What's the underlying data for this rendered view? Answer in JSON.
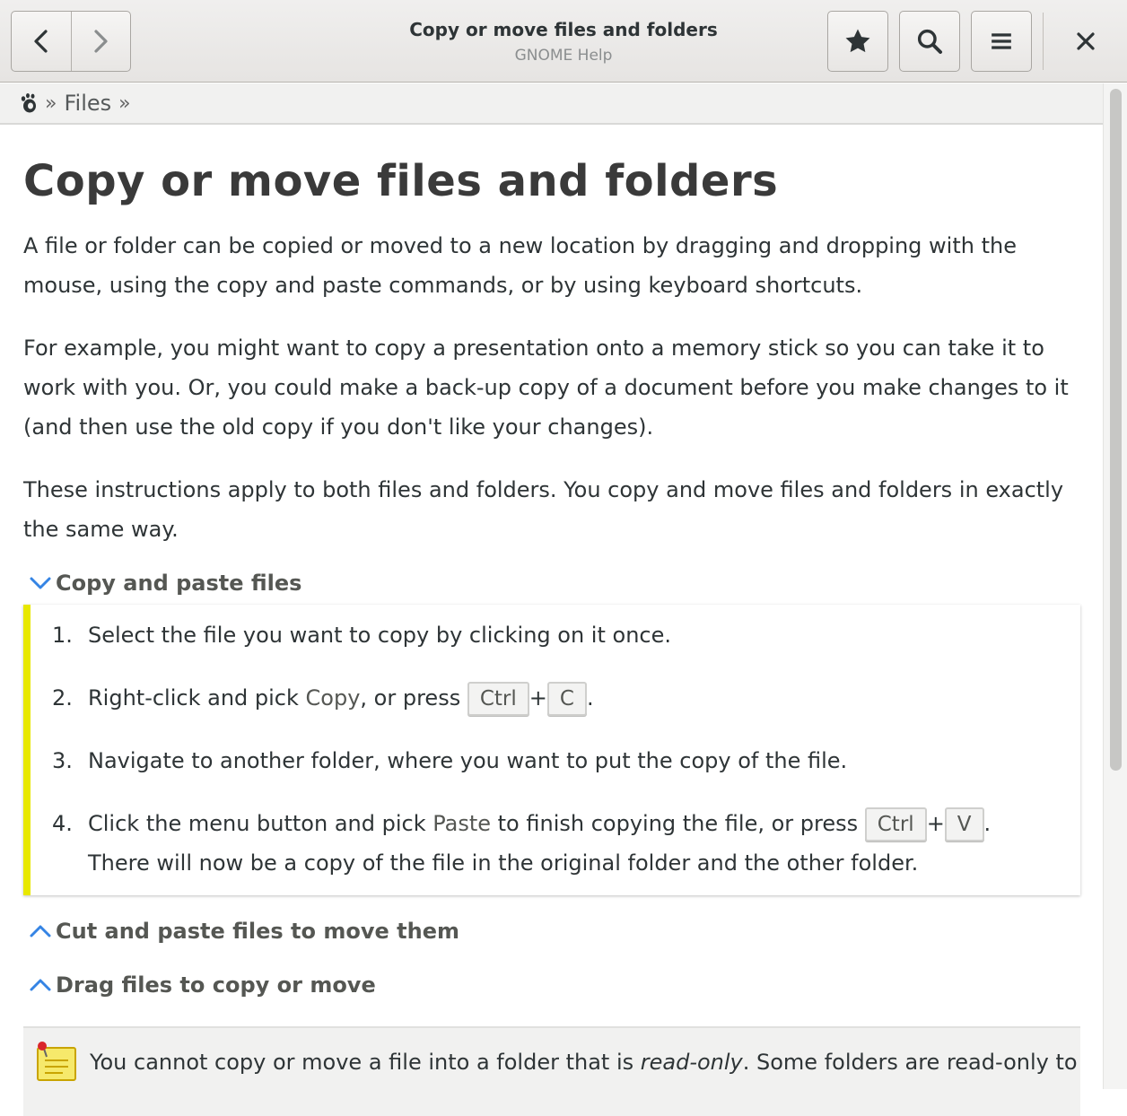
{
  "header": {
    "title": "Copy or move files and folders",
    "subtitle": "GNOME Help",
    "icons": [
      "back-arrow-icon",
      "forward-arrow-icon",
      "bookmark-star-icon",
      "search-icon",
      "menu-icon",
      "close-icon"
    ]
  },
  "breadcrumb": {
    "items": [
      "Files"
    ],
    "separator": "»"
  },
  "page": {
    "heading": "Copy or move files and folders",
    "paragraphs": [
      "A file or folder can be copied or moved to a new location by dragging and dropping with the mouse, using the copy and paste commands, or by using keyboard shortcuts.",
      "For example, you might want to copy a presentation onto a memory stick so you can take it to work with you. Or, you could make a back-up copy of a document before you make changes to it (and then use the old copy if you don't like your changes).",
      "These instructions apply to both files and folders. You copy and move files and folders in exactly the same way."
    ]
  },
  "sections": {
    "copy_paste": {
      "title": "Copy and paste files",
      "expanded": true
    },
    "cut_paste": {
      "title": "Cut and paste files to move them",
      "expanded": false
    },
    "drag": {
      "title": "Drag files to copy or move",
      "expanded": false
    }
  },
  "steps": {
    "s1": {
      "num": "1.",
      "text": "Select the file you want to copy by clicking on it once."
    },
    "s2": {
      "num": "2.",
      "pre": "Right-click and pick ",
      "gui": "Copy",
      "mid": ", or press ",
      "key1": "Ctrl",
      "plus": "+",
      "key2": "C",
      "end": "."
    },
    "s3": {
      "num": "3.",
      "text": "Navigate to another folder, where you want to put the copy of the file."
    },
    "s4": {
      "num": "4.",
      "pre": "Click the menu button and pick ",
      "gui": "Paste",
      "mid": " to finish copying the file, or press ",
      "key1": "Ctrl",
      "plus": "+",
      "key2": "V",
      "end": ".",
      "line2": "There will now be a copy of the file in the original folder and the other folder."
    }
  },
  "note": {
    "pre": "You cannot copy or move a file into a folder that is ",
    "em": "read-only",
    "post": ". Some folders are read-only to"
  },
  "colors": {
    "accent_blue": "#3584e4",
    "steps_bar": "#e8e800",
    "note_bg": "#f1f1f0"
  }
}
